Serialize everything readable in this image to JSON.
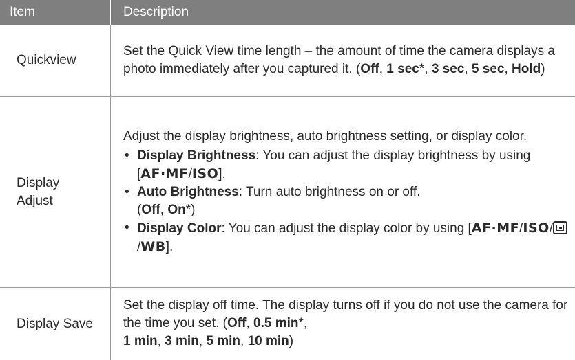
{
  "header": {
    "item": "Item",
    "description": "Description"
  },
  "rows": [
    {
      "item": "Quickview",
      "text": "Set the Quick View time length – the amount of time the camera displays a photo immediately after you captured it. (",
      "options": [
        "Off",
        "1 sec",
        "3 sec",
        "5 sec",
        "Hold"
      ],
      "default_marker": "*"
    },
    {
      "item_line1": "Display",
      "item_line2": "Adjust",
      "intro": "Adjust the display brightness, auto brightness setting, or display color.",
      "bullets": [
        {
          "term": "Display Brightness",
          "text": ": You can adjust the display brightness by using [",
          "keys": [
            "AF·MF",
            "ISO"
          ]
        },
        {
          "term": "Auto Brightness",
          "text": ": Turn auto brightness on or off.",
          "options": [
            "Off",
            "On"
          ]
        },
        {
          "term": "Display Color",
          "text": ": You can adjust the display color by using [",
          "keys": [
            "AF·MF",
            "ISO",
            "WB"
          ],
          "icon": "ev-frame-icon"
        }
      ]
    },
    {
      "item": "Display Save",
      "text": "Set the display off time. The display turns off if you do not use the camera for the time you set. (",
      "options": [
        "Off",
        "0.5 min",
        "1 min",
        "3 min",
        "5 min",
        "10 min"
      ]
    }
  ],
  "punct": {
    "comma": ", ",
    "slash": "/",
    "close_paren": ")",
    "open_paren": "(",
    "close_bracket": "].",
    "star": "*"
  }
}
